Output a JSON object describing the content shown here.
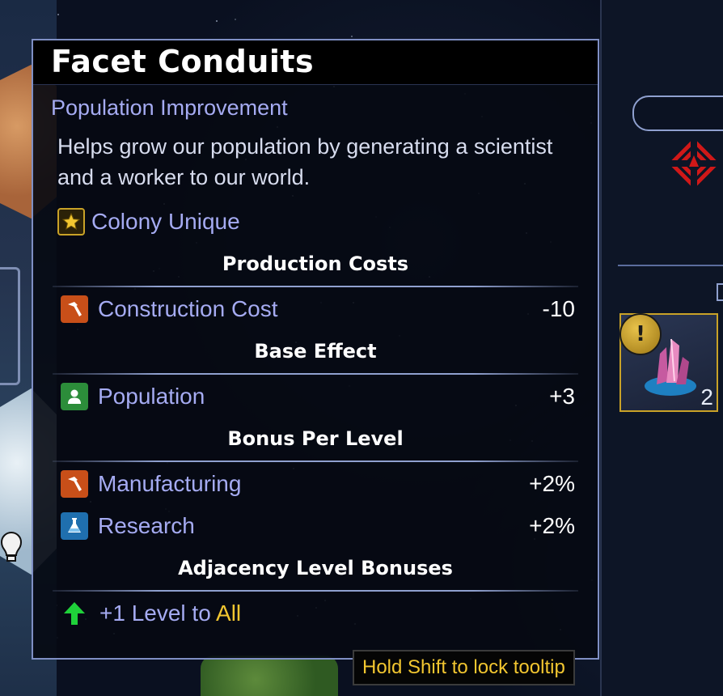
{
  "tooltip": {
    "title": "Facet Conduits",
    "subtitle": "Population Improvement",
    "description": "Helps grow our population by generating a scientist and a worker to our world.",
    "unique_label": "Colony Unique",
    "sections": {
      "production_costs": "Production Costs",
      "base_effect": "Base Effect",
      "bonus_per_level": "Bonus Per Level",
      "adjacency": "Adjacency Level Bonuses"
    },
    "rows": {
      "construction": {
        "label": "Construction Cost",
        "value": "-10",
        "icon": "hammer-icon"
      },
      "population": {
        "label": "Population",
        "value": "+3",
        "icon": "person-icon"
      },
      "manufacturing": {
        "label": "Manufacturing",
        "value": "+2%",
        "icon": "hammer-icon"
      },
      "research": {
        "label": "Research",
        "value": "+2%",
        "icon": "flask-icon"
      }
    },
    "adjacency": {
      "prefix": "+1 Level to",
      "target": "All",
      "icon": "green-up-arrow-icon"
    }
  },
  "hint": "Hold Shift to lock tooltip",
  "right_panel": {
    "card_count": "2",
    "card_badge": "!",
    "card_icon": "crystal-icon"
  },
  "colors": {
    "accent_label": "#a5abf2",
    "highlight_yellow": "#f2c630",
    "border": "#7f8fc4",
    "construction_icon": "#c84f19",
    "population_icon": "#2c8d3a",
    "research_icon": "#1f6fae"
  }
}
